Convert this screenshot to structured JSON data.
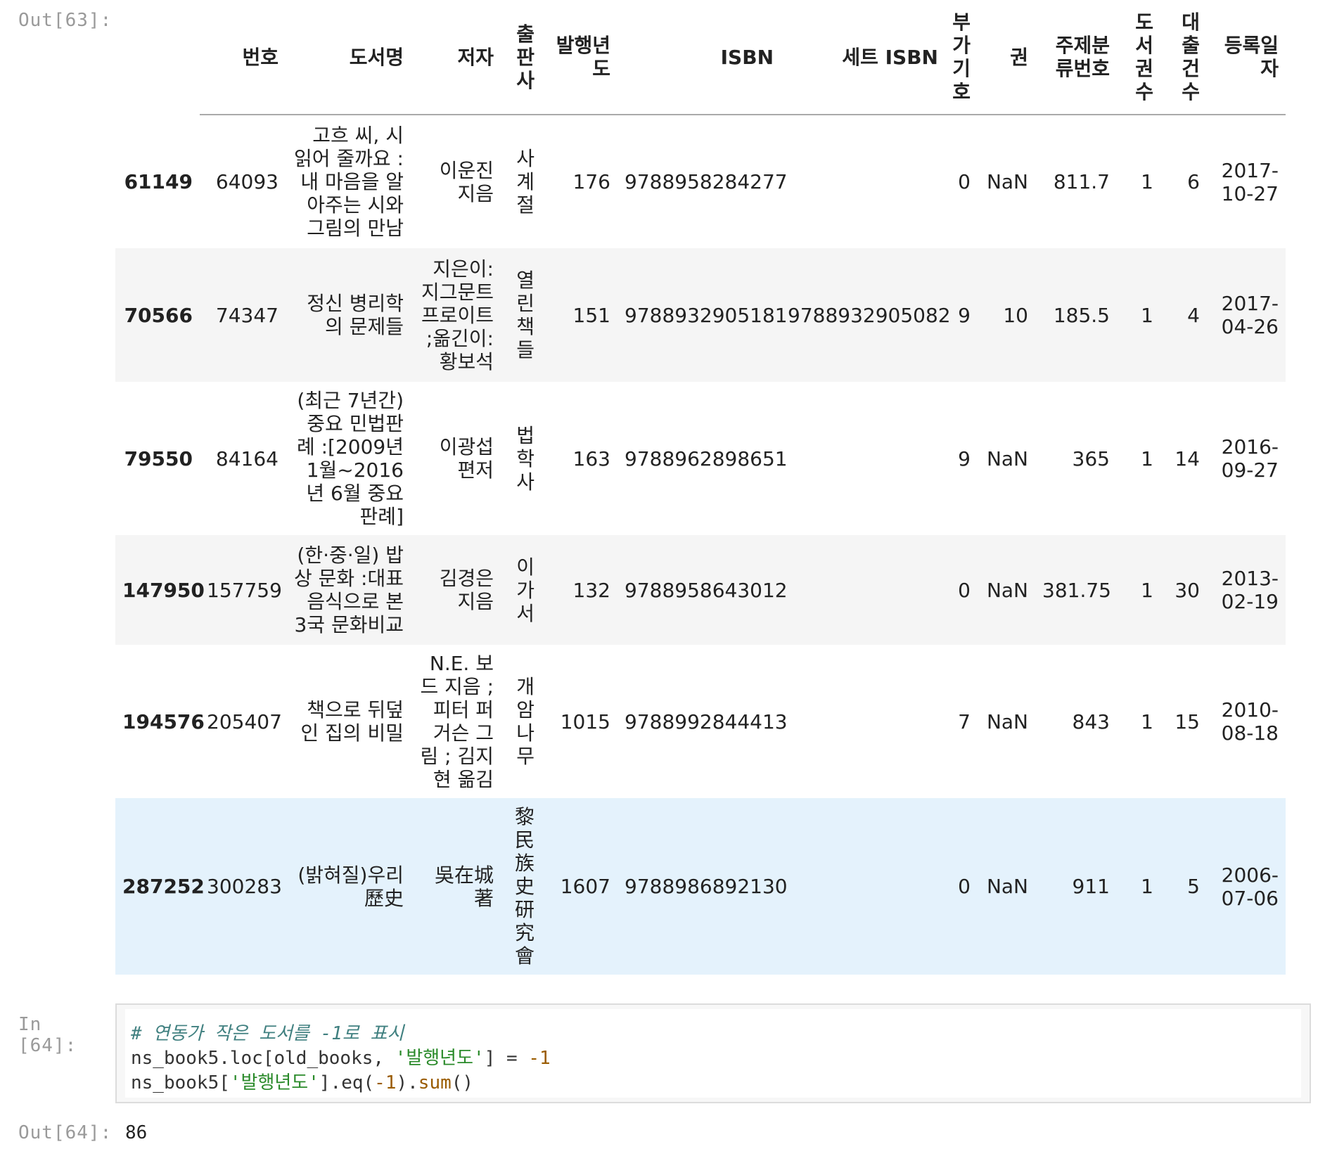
{
  "out63_prompt": "Out[63]:",
  "in64_prompt": "In [64]:",
  "out64_prompt": "Out[64]:",
  "table": {
    "columns": [
      "번호",
      "도서명",
      "저자",
      "출판사",
      "발행년도",
      "ISBN",
      "세트 ISBN",
      "부가기호",
      "권",
      "주제분류번호",
      "도서권수",
      "대출건수",
      "등록일자"
    ],
    "rows": [
      {
        "index": "61149",
        "cells": [
          "64093",
          "고흐 씨, 시 읽어 줄까요 :내 마음을 알아주는 시와 그림의 만남",
          "이운진 지음",
          "사계절",
          "176",
          "9788958284277",
          "",
          "0",
          "NaN",
          "811.7",
          "1",
          "6",
          "2017-10-27"
        ]
      },
      {
        "index": "70566",
        "cells": [
          "74347",
          "정신 병리학의 문제들",
          "지은이: 지그문트 프로이트 ;옮긴이: 황보석",
          "열린책들",
          "151",
          "9788932905181",
          "9788932905082",
          "9",
          "10",
          "185.5",
          "1",
          "4",
          "2017-04-26"
        ]
      },
      {
        "index": "79550",
        "cells": [
          "84164",
          "(최근 7년간) 중요 민법판례 :[2009년 1월~2016년 6월 중요 판례]",
          "이광섭 편저",
          "법학사",
          "163",
          "9788962898651",
          "",
          "9",
          "NaN",
          "365",
          "1",
          "14",
          "2016-09-27"
        ]
      },
      {
        "index": "147950",
        "cells": [
          "157759",
          "(한·중·일) 밥상 문화 :대표 음식으로 본 3국 문화비교",
          "김경은 지음",
          "이가서",
          "132",
          "9788958643012",
          "",
          "0",
          "NaN",
          "381.75",
          "1",
          "30",
          "2013-02-19"
        ]
      },
      {
        "index": "194576",
        "cells": [
          "205407",
          "책으로 뒤덮인 집의 비밀",
          "N.E. 보드 지음 ; 피터 퍼거슨 그림 ; 김지현 옮김",
          "개암나무",
          "1015",
          "9788992844413",
          "",
          "7",
          "NaN",
          "843",
          "1",
          "15",
          "2010-08-18"
        ]
      },
      {
        "index": "287252",
        "cells": [
          "300283",
          "(밝혀질)우리歷史",
          "吳在城 著",
          "黎民族史研究會",
          "1607",
          "9788986892130",
          "",
          "0",
          "NaN",
          "911",
          "1",
          "5",
          "2006-07-06"
        ]
      }
    ]
  },
  "code": {
    "line1": "# 연동가 작은 도서를 -1로 표시",
    "line2_a": "ns_book5.loc[old_books, ",
    "line2_str": "'발행년도'",
    "line2_b": "] = ",
    "line2_num": "-1",
    "line3_a": "ns_book5[",
    "line3_str": "'발행년도'",
    "line3_b": "].eq(",
    "line3_num": "-1",
    "line3_c": ").",
    "line3_fn": "sum",
    "line3_d": "()"
  },
  "result": "86"
}
